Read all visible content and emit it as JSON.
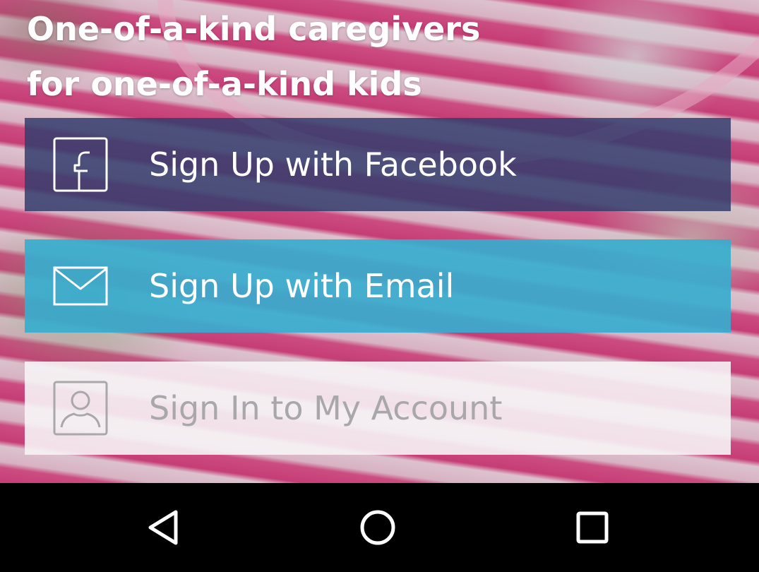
{
  "headline": {
    "line1": "One-of-a-kind caregivers",
    "line2": "for one-of-a-kind kids"
  },
  "buttons": {
    "facebook": {
      "label": "Sign Up with Facebook",
      "icon": "facebook-icon",
      "color": "#343e6e"
    },
    "email": {
      "label": "Sign Up with Email",
      "icon": "envelope-icon",
      "color": "#38acce"
    },
    "signin": {
      "label": "Sign In to My Account",
      "icon": "person-icon",
      "color": "#f6f3f5"
    }
  },
  "navbar": {
    "back": "back-icon",
    "home": "home-icon",
    "recents": "recents-icon"
  }
}
